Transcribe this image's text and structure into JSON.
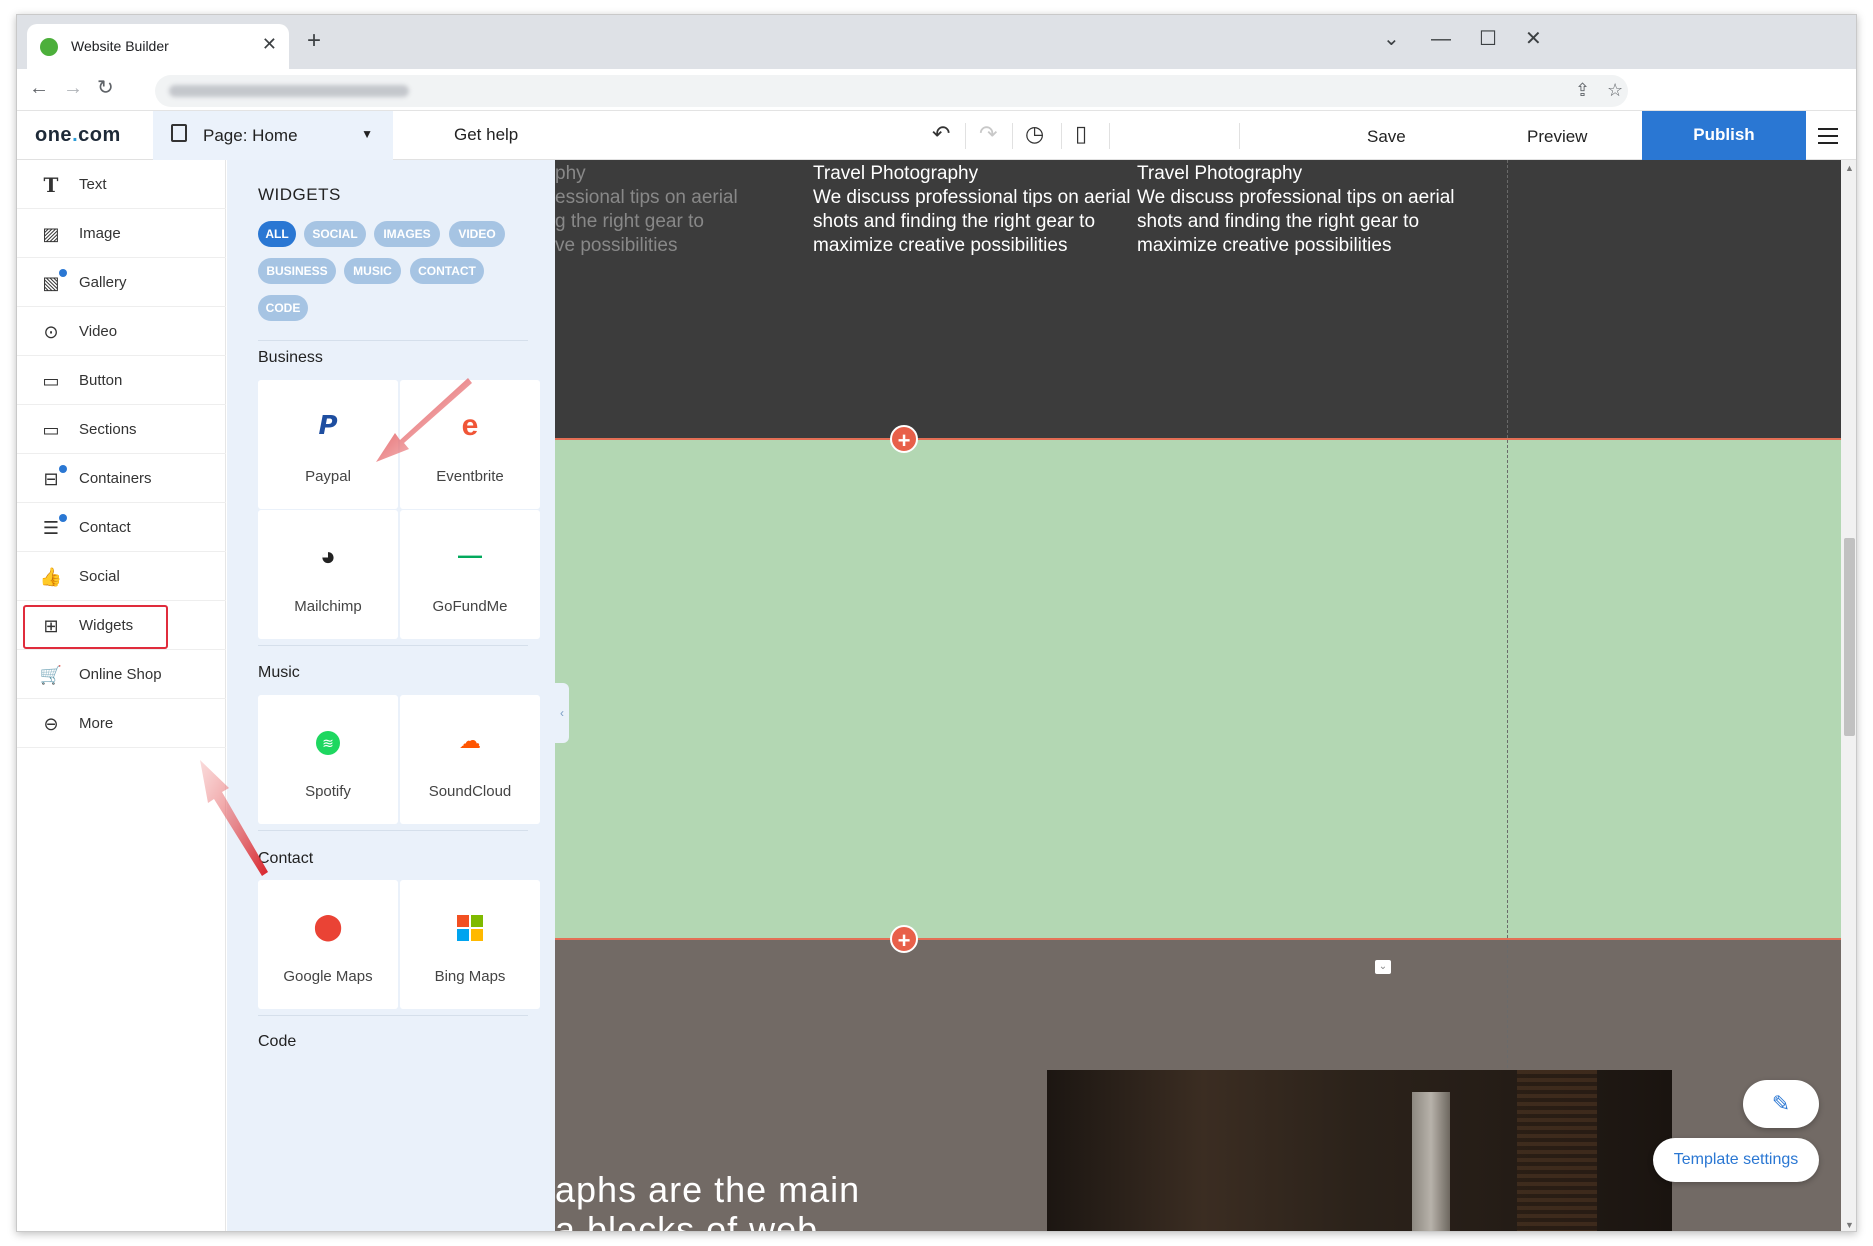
{
  "browser": {
    "tab_title": "Website Builder",
    "url_placeholder": "websitebuilder.staging.one.com/...",
    "icons": {
      "back": "arrow-left-icon",
      "forward": "arrow-right-icon",
      "reload": "reload-icon",
      "share": "share-icon",
      "bookmark": "star-icon"
    }
  },
  "header": {
    "logo": "one",
    "logo_dot": ".",
    "logo_tld": "com",
    "page_label": "Page:",
    "page_value": "Home",
    "get_help": "Get help",
    "save": "Save",
    "preview": "Preview",
    "publish": "Publish",
    "accent": "#2a77d3"
  },
  "sidebar": {
    "items": [
      {
        "label": "Text",
        "icon": "T"
      },
      {
        "label": "Image",
        "icon": "image-icon"
      },
      {
        "label": "Gallery",
        "icon": "gallery-icon"
      },
      {
        "label": "Video",
        "icon": "video-icon"
      },
      {
        "label": "Button",
        "icon": "button-icon"
      },
      {
        "label": "Sections",
        "icon": "sections-icon"
      },
      {
        "label": "Containers",
        "icon": "containers-icon"
      },
      {
        "label": "Contact",
        "icon": "contact-icon"
      },
      {
        "label": "Social",
        "icon": "thumbs-up-icon"
      },
      {
        "label": "Widgets",
        "icon": "widgets-icon"
      },
      {
        "label": "Online Shop",
        "icon": "cart-icon"
      },
      {
        "label": "More",
        "icon": "more-icon"
      }
    ]
  },
  "widgets_panel": {
    "title": "WIDGETS",
    "filters": [
      "ALL",
      "SOCIAL",
      "IMAGES",
      "VIDEO",
      "BUSINESS",
      "MUSIC",
      "CONTACT",
      "CODE"
    ],
    "active_filter": "ALL",
    "sections": [
      {
        "name": "Business",
        "cards": [
          "Paypal",
          "Eventbrite",
          "Mailchimp",
          "GoFundMe"
        ]
      },
      {
        "name": "Music",
        "cards": [
          "Spotify",
          "SoundCloud"
        ]
      },
      {
        "name": "Contact",
        "cards": [
          "Google Maps",
          "Bing Maps"
        ]
      },
      {
        "name": "Code",
        "cards": []
      }
    ]
  },
  "canvas": {
    "col1_lines": [
      "phy",
      "essional tips on aerial",
      "g the right gear to",
      "ve possibilities"
    ],
    "col2_title": "Travel Photography",
    "col2_lines": [
      "We discuss professional tips on aerial",
      "shots and finding the right gear to",
      "maximize creative possibilities"
    ],
    "col3_title": "Travel Photography",
    "col3_lines": [
      "We discuss professional tips on aerial",
      "shots and finding the right gear to",
      "maximize creative possibilities"
    ],
    "big_text_1": "aphs are the main",
    "big_text_2": "a blocks of web",
    "template_settings": "Template settings",
    "colors": {
      "dark": "#3c3c3c",
      "green": "#b3d7b3",
      "brown": "#726a65",
      "guide": "#e36f55"
    }
  }
}
